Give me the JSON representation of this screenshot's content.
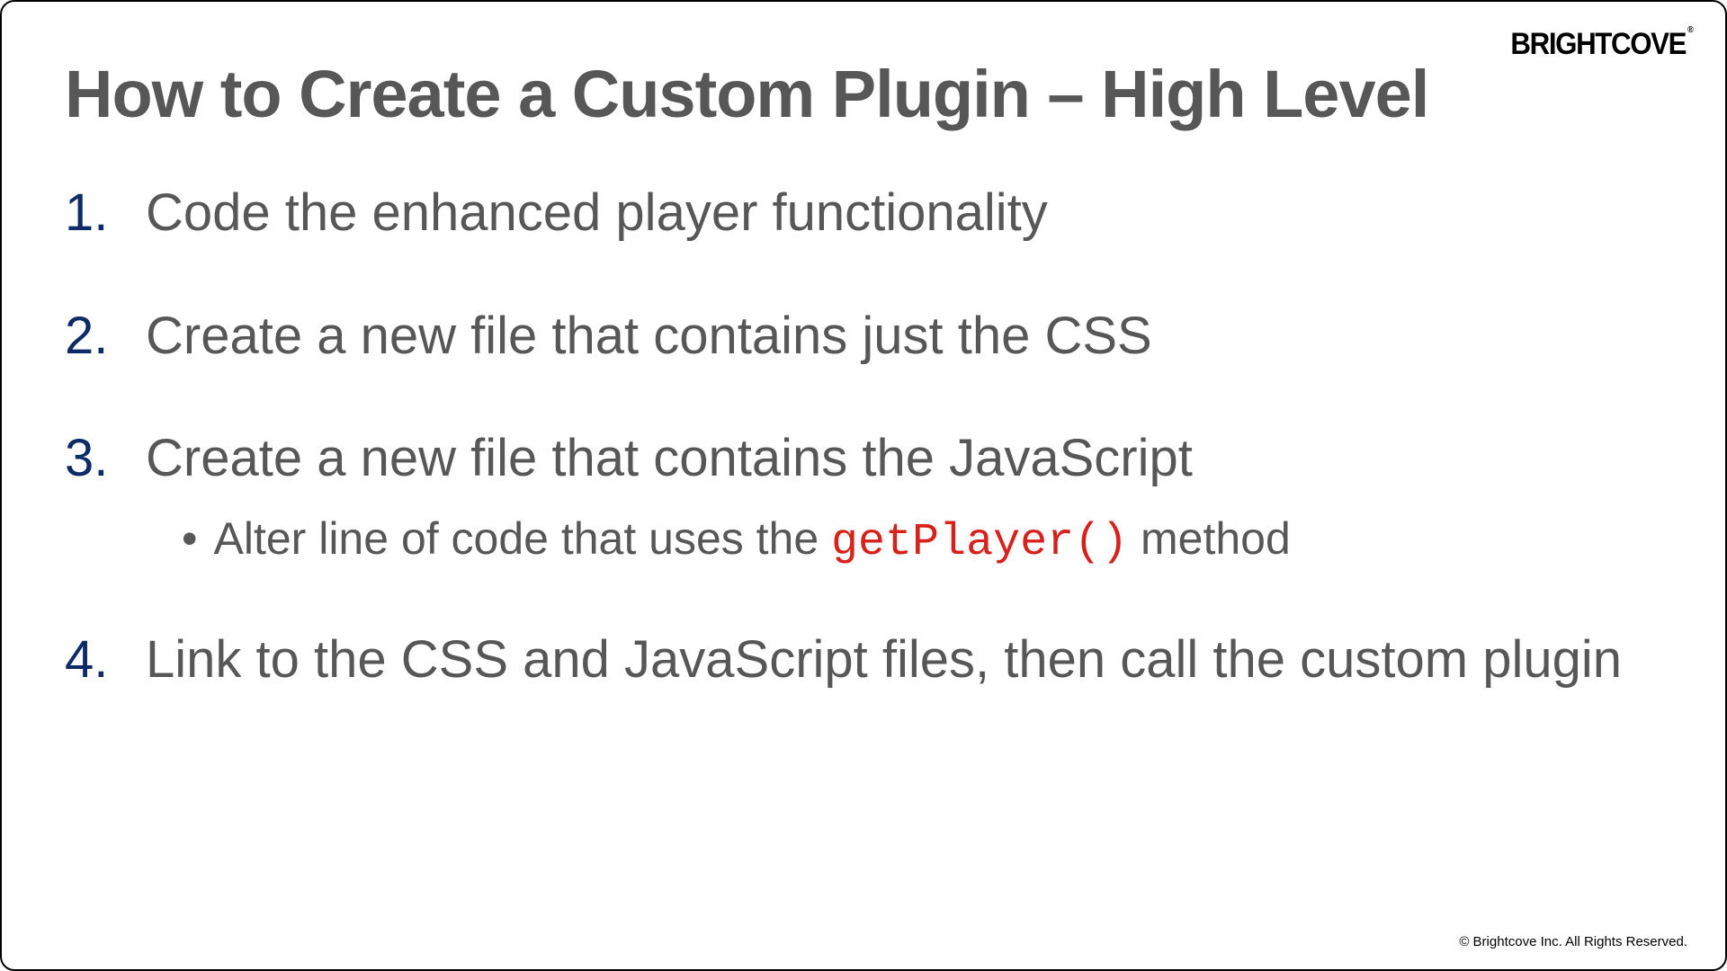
{
  "logo": "BRIGHTCOVE",
  "title": "How to Create a Custom Plugin – High Level",
  "items": [
    {
      "num": "1.",
      "text": "Code the enhanced player functionality"
    },
    {
      "num": "2.",
      "text": "Create a new file that contains just the CSS"
    },
    {
      "num": "3.",
      "text": "Create a new file that contains the JavaScript",
      "sub_pre": "Alter line of code that uses the ",
      "sub_code": "getPlayer()",
      "sub_post": " method"
    },
    {
      "num": "4.",
      "text": "Link to the CSS and JavaScript files, then call the custom plugin"
    }
  ],
  "footer": "© Brightcove Inc. All Rights Reserved."
}
